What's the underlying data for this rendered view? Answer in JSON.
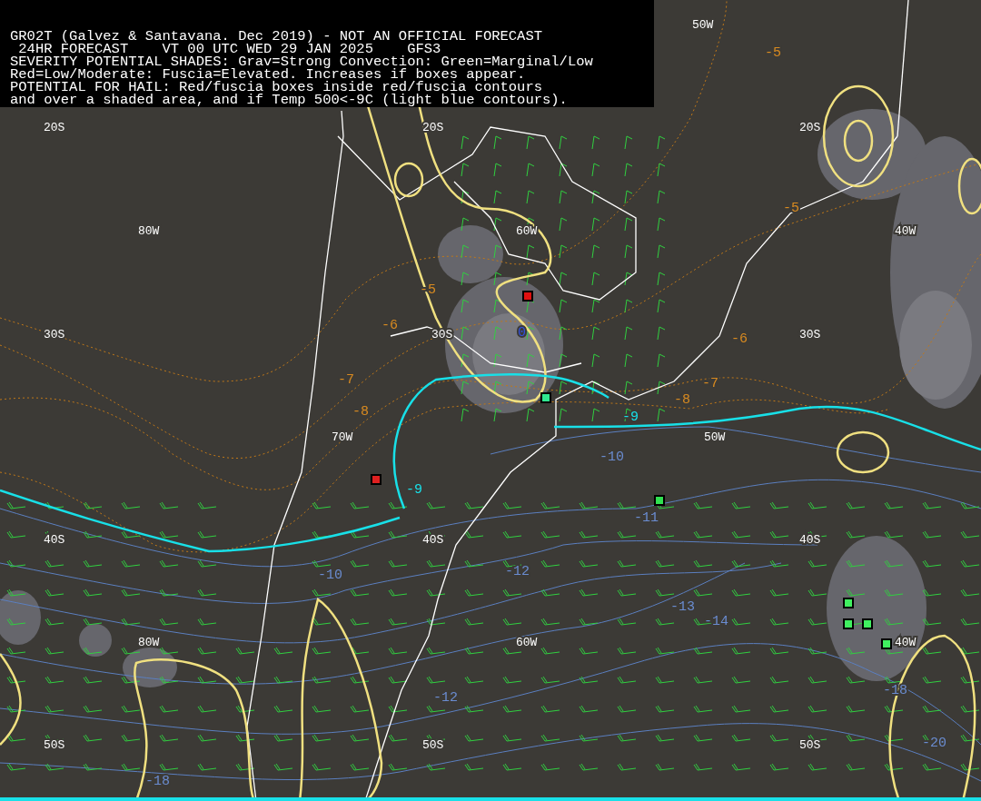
{
  "header": {
    "lines": [
      "GR02T (Galvez & Santavana. Dec 2019) - NOT AN OFFICIAL FORECAST",
      " 24HR FORECAST    VT 00 UTC WED 29 JAN 2025    GFS3",
      "SEVERITY POTENTIAL SHADES: Grav=Strong Convection: Green=Marginal/Low",
      "Red=Low/Moderate: Fuscia=Elevated. Increases if boxes appear.",
      "POTENTIAL FOR HAIL: Red/fuscia boxes inside red/fuscia contours",
      "and over a shaded area, and if Temp 500<-9C (light blue contours)."
    ]
  },
  "grid_labels": [
    "50W",
    "20S",
    "20S",
    "20S",
    "80W",
    "60W",
    "40W",
    "30S",
    "30S",
    "30S",
    "70W",
    "50W",
    "40S",
    "40S",
    "40S",
    "80W",
    "60W",
    "40W",
    "50S",
    "50S",
    "50S"
  ],
  "contour_labels": [
    {
      "text": "-5",
      "kind": "pressure"
    },
    {
      "text": "-5",
      "kind": "pressure"
    },
    {
      "text": "-5",
      "kind": "pressure"
    },
    {
      "text": "-6",
      "kind": "pressure"
    },
    {
      "text": "-6",
      "kind": "pressure"
    },
    {
      "text": "-7",
      "kind": "pressure"
    },
    {
      "text": "-7",
      "kind": "pressure"
    },
    {
      "text": "-8",
      "kind": "pressure"
    },
    {
      "text": "-8",
      "kind": "pressure"
    },
    {
      "text": "-9",
      "kind": "threshold"
    },
    {
      "text": "-9",
      "kind": "threshold"
    },
    {
      "text": "0",
      "kind": "severity"
    },
    {
      "text": "-10",
      "kind": "temperature"
    },
    {
      "text": "-10",
      "kind": "temperature"
    },
    {
      "text": "-11",
      "kind": "temperature"
    },
    {
      "text": "-12",
      "kind": "temperature"
    },
    {
      "text": "-12",
      "kind": "temperature"
    },
    {
      "text": "-13",
      "kind": "temperature"
    },
    {
      "text": "-14",
      "kind": "temperature"
    },
    {
      "text": "-18",
      "kind": "temperature"
    },
    {
      "text": "-20",
      "kind": "temperature"
    },
    {
      "text": "-18",
      "kind": "temperature"
    }
  ],
  "markers": [
    {
      "color": "#e01010"
    },
    {
      "color": "#e02020"
    },
    {
      "color": "#30e890"
    },
    {
      "color": "#30e050"
    },
    {
      "color": "#40f060"
    },
    {
      "color": "#40f060"
    },
    {
      "color": "#40f060"
    },
    {
      "color": "#40f060"
    }
  ]
}
